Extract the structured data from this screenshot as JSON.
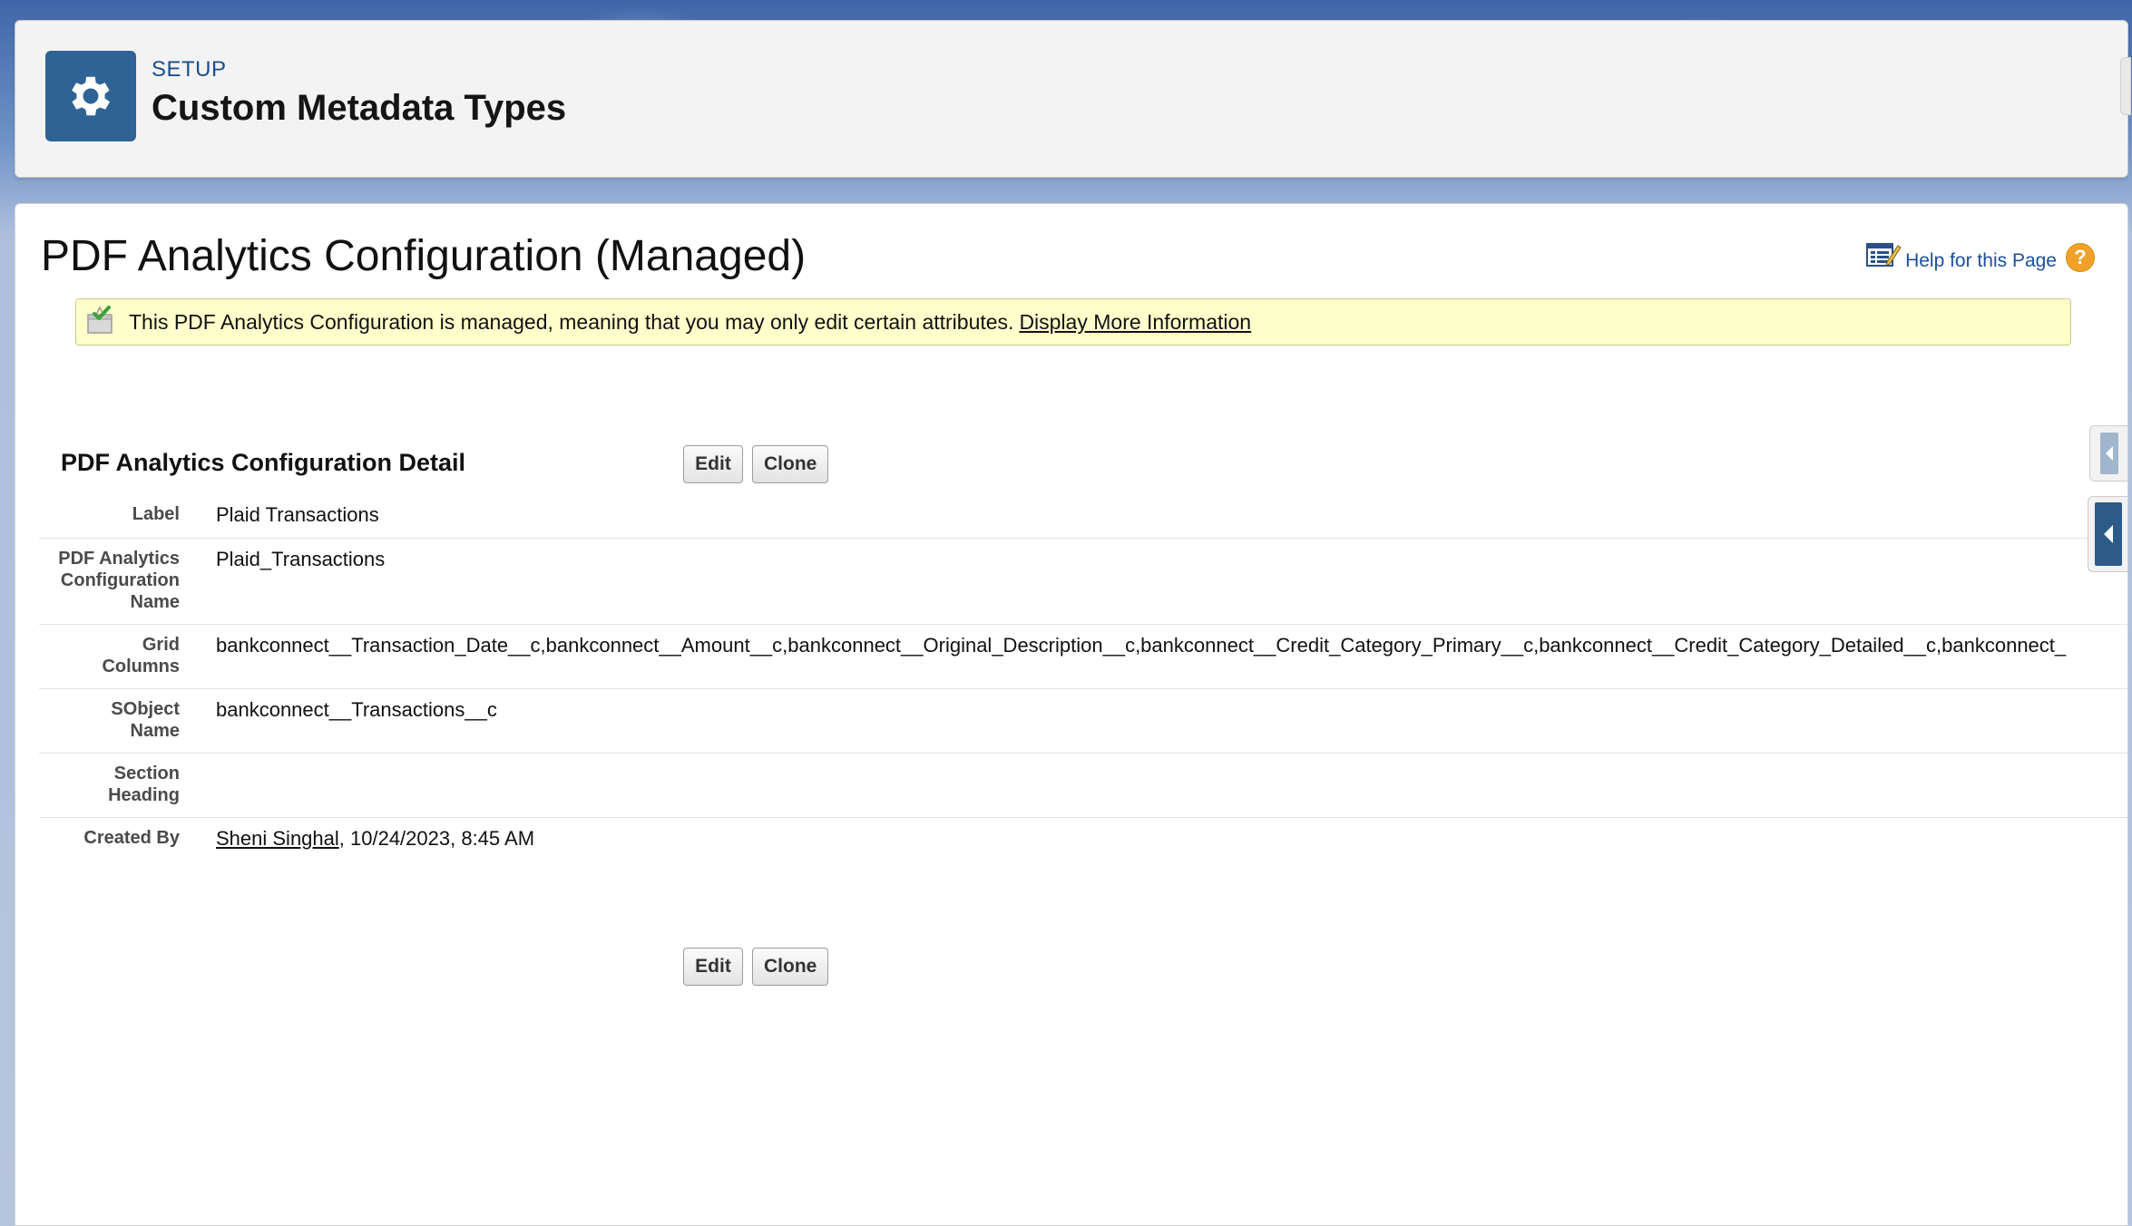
{
  "header": {
    "eyebrow": "SETUP",
    "title": "Custom Metadata Types",
    "icon": "gear-icon"
  },
  "page": {
    "title": "PDF Analytics Configuration (Managed)",
    "help_label": "Help for this Page",
    "help_icons": [
      "help-page-icon",
      "question-circle-icon"
    ]
  },
  "info_bar": {
    "message": "This PDF Analytics Configuration is managed, meaning that you may only edit certain attributes.",
    "link": "Display More Information",
    "icon": "managed-package-icon"
  },
  "detail": {
    "title": "PDF Analytics Configuration Detail",
    "edit_label": "Edit",
    "clone_label": "Clone",
    "rows": [
      {
        "label": "Label",
        "value": "Plaid Transactions"
      },
      {
        "label": "PDF Analytics Configuration Name",
        "value": "Plaid_Transactions"
      },
      {
        "label": "Grid Columns",
        "value": "bankconnect__Transaction_Date__c,bankconnect__Amount__c,bankconnect__Original_Description__c,bankconnect__Credit_Category_Primary__c,bankconnect__Credit_Category_Detailed__c,bankconnect_"
      },
      {
        "label": "SObject Name",
        "value": "bankconnect__Transactions__c"
      },
      {
        "label": "Section Heading",
        "value": ""
      },
      {
        "label": "Created By",
        "user": "Sheni Singhal",
        "value": ", 10/24/2023, 8:45 AM"
      }
    ]
  },
  "colors": {
    "header_icon_bg": "#2f6396",
    "info_bar_bg": "#ffffcc",
    "link_blue": "#1d4f9a",
    "help_orange": "#f0a12a"
  }
}
